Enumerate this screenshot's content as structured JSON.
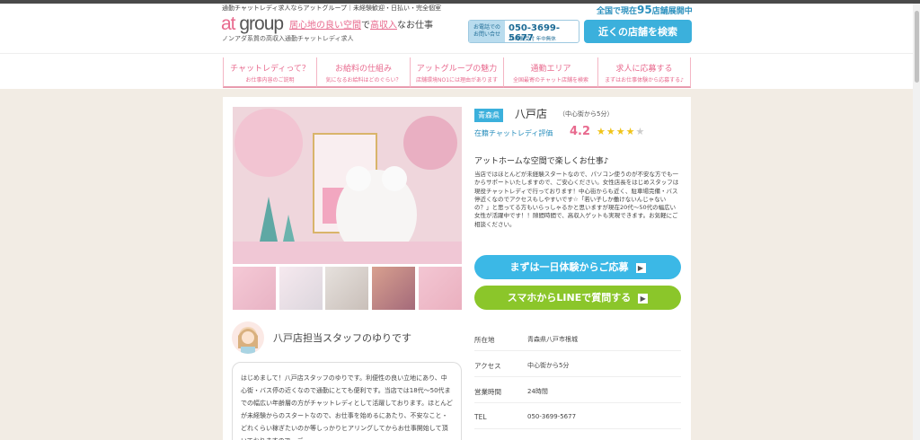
{
  "header": {
    "tagline": "通勤チャットレディ求人ならアットグループ｜未経験歓迎・日払い・完全個室",
    "logo_left": "at",
    "logo_right": "group",
    "catch_prefix": "居心地の良い空間",
    "catch_mid": "で",
    "catch_highlight": "高収入",
    "catch_suffix": "なお仕事",
    "subline": "ノンアダ系質の高収入通勤チャットレディ求人",
    "stores_prefix": "全国で現在",
    "stores_count": "95",
    "stores_suffix": "店舗展開中",
    "phone_label": "お電話での お問い合せ",
    "phone_number": "050-3699-5677",
    "phone_hours": "24時間受付 年中無休",
    "search_button": "近くの店舗を検索"
  },
  "nav": [
    {
      "title": "チャットレディって？",
      "sub": "お仕事内容のご説明"
    },
    {
      "title": "お給料の仕組み",
      "sub": "気になるお給料はどのぐらい？"
    },
    {
      "title": "アットグループの魅力",
      "sub": "店舗環境NO1には理由があります"
    },
    {
      "title": "通勤エリア",
      "sub": "全国最寄のチャット店舗を検索"
    },
    {
      "title": "求人に応募する",
      "sub": "まずはお仕事体験から応募する♪"
    }
  ],
  "store": {
    "prefecture": "青森県",
    "name": "八戸店",
    "distance": "（中心街から5分）",
    "rating_label": "在籍チャットレディ評価",
    "rating_value": "4.2",
    "stars_filled": "★★★★",
    "stars_empty": "★",
    "intro_title": "アットホームな空間で楽しくお仕事♪",
    "intro_body": "当店ではほとんどが未経験スタートなので、パソコン使うのが不安な方でも一からサポートいたしますので、ご安心ください。女性店長をはじめスタッフは現役チャットレディで行っております！中心街からも近く、駐車場完備・バス停近くなのでアクセスもしやすいです☆「若い子しか働けないんじゃないの？」と思ってる方もいらっしゃるかと思いますが現在20代～50代の幅広い女性が活躍中です！！隙間時間で、高収入ゲットも実現できます。お気軽にご相談ください。",
    "cta_trial": "まずは一日体験からご応募",
    "cta_line": "スマホからLINEで質問する",
    "cta_arrow": "▶"
  },
  "staff": {
    "title": "八戸店担当スタッフのゆりです",
    "message": "はじめまして！八戸店スタッフのゆりです。利便性の良い立地にあり、中心街・バス停の近くなので通勤にとても便利です。当店では18代〜50代までの幅広い年齢層の方がチャットレディとして活躍しております。ほとんどが未経験からのスタートなので、お仕事を始めるにあたり、不安なこと・どれくらい稼ぎたいのか等しっかりヒアリングしてからお仕事開始して頂いておりますので、ご"
  },
  "info": [
    {
      "key": "所在地",
      "value": "青森県八戸市根城"
    },
    {
      "key": "アクセス",
      "value": "中心街から5分"
    },
    {
      "key": "営業時間",
      "value": "24時間"
    },
    {
      "key": "TEL",
      "value": "050-3699-5677"
    }
  ],
  "colors": {
    "accent_pink": "#e86a8e",
    "accent_blue": "#3bb0dc",
    "line_green": "#8bc62a"
  }
}
